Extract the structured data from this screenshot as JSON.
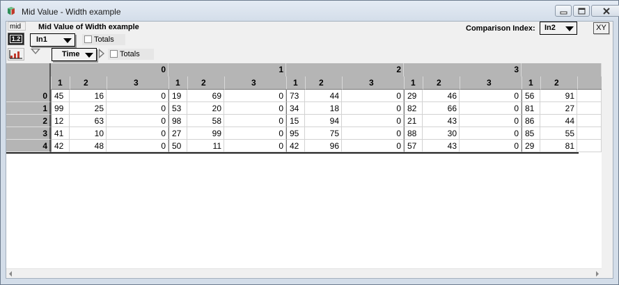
{
  "window": {
    "title": "Mid Value - Width example"
  },
  "toolbar": {
    "mid_label": "mid",
    "table_icon_label": "1.2"
  },
  "header": {
    "title": "Mid Value of Width example",
    "index1": {
      "value": "In1"
    },
    "totals1_label": "Totals",
    "index2": {
      "value": "Time"
    },
    "totals2_label": "Totals",
    "comparison_label": "Comparison Index:",
    "comparison": {
      "value": "In2"
    },
    "xy_label": "XY"
  },
  "table": {
    "groups": [
      "0",
      "1",
      "2",
      "3",
      ""
    ],
    "subheaders": [
      "1",
      "2",
      "3"
    ],
    "rows": [
      {
        "label": "0",
        "cells": [
          "45",
          "16",
          "0",
          "19",
          "69",
          "0",
          "73",
          "44",
          "0",
          "29",
          "46",
          "0",
          "56",
          "91"
        ]
      },
      {
        "label": "1",
        "cells": [
          "99",
          "25",
          "0",
          "53",
          "20",
          "0",
          "34",
          "18",
          "0",
          "82",
          "66",
          "0",
          "81",
          "27"
        ]
      },
      {
        "label": "2",
        "cells": [
          "12",
          "63",
          "0",
          "98",
          "58",
          "0",
          "15",
          "94",
          "0",
          "21",
          "43",
          "0",
          "86",
          "44"
        ]
      },
      {
        "label": "3",
        "cells": [
          "41",
          "10",
          "0",
          "27",
          "99",
          "0",
          "95",
          "75",
          "0",
          "88",
          "30",
          "0",
          "85",
          "55"
        ]
      },
      {
        "label": "4",
        "cells": [
          "42",
          "48",
          "0",
          "50",
          "11",
          "0",
          "42",
          "96",
          "0",
          "57",
          "43",
          "0",
          "29",
          "81"
        ]
      }
    ]
  }
}
